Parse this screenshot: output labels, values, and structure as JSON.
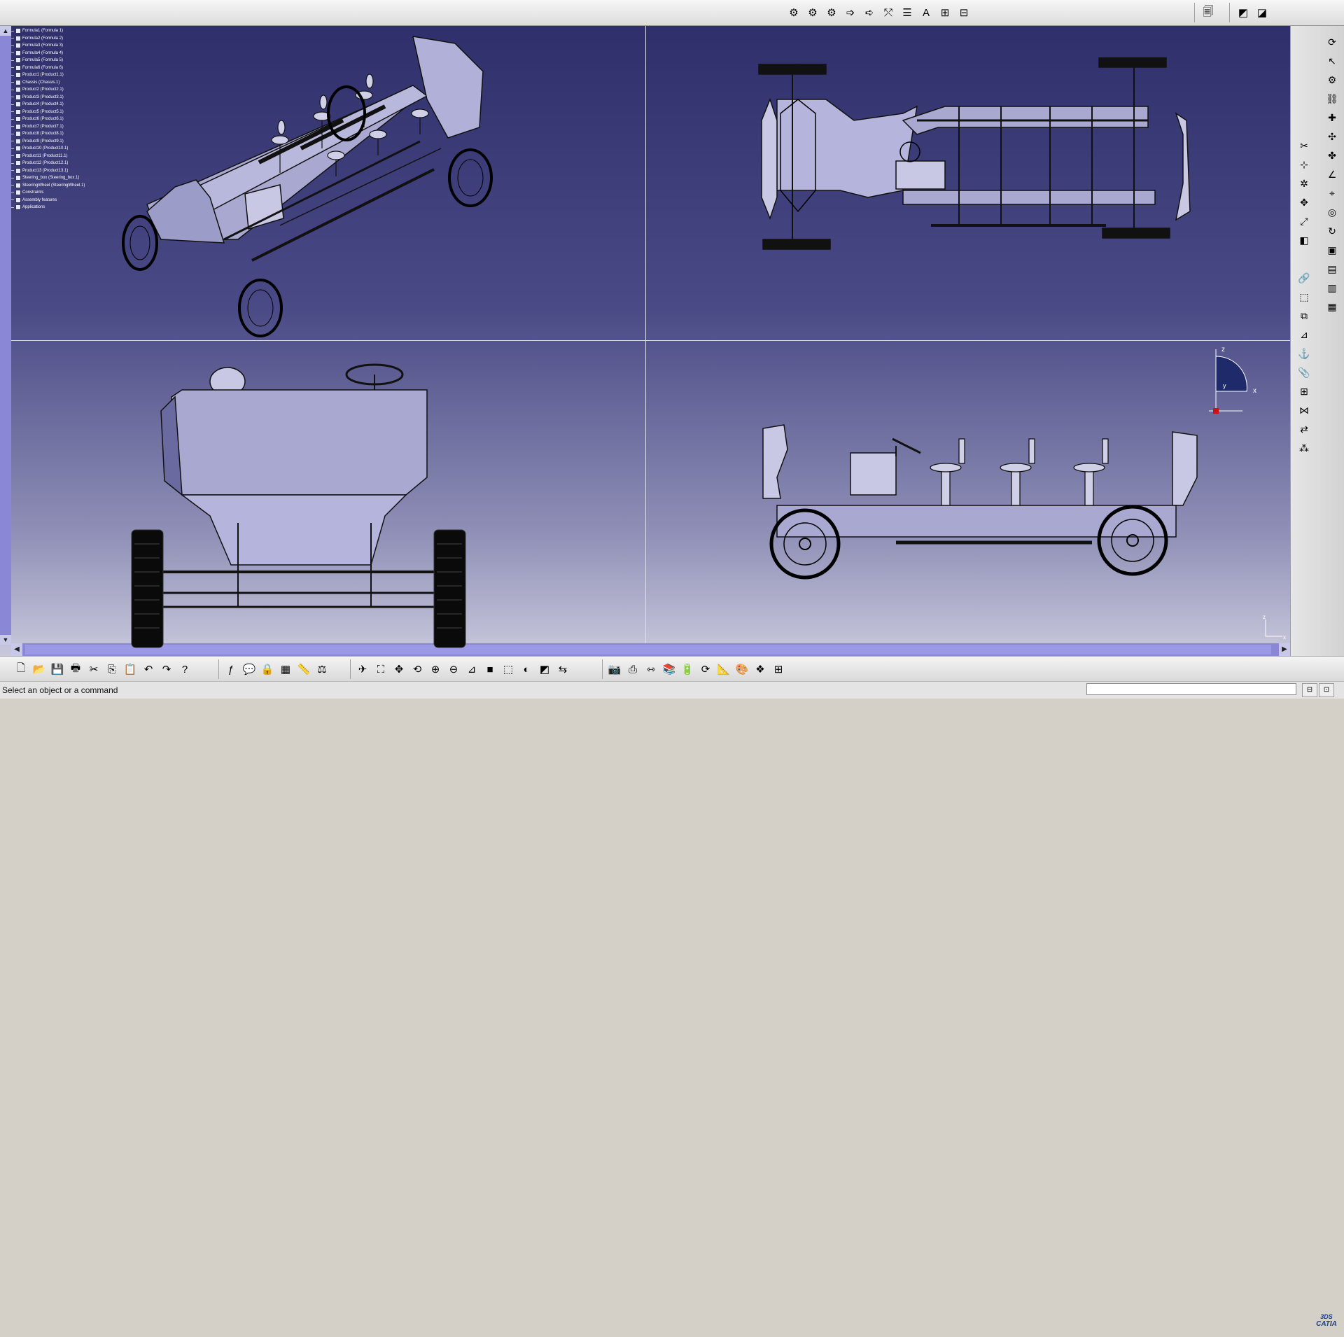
{
  "app": {
    "brand": "CATIA",
    "brand_prefix": "3DS"
  },
  "colors": {
    "viewport_top": "#2f2f6b",
    "viewport_bottom": "#c8c8dc",
    "model_fill": "#a8a8d0",
    "scroll": "#8a88d6"
  },
  "tree": {
    "items": [
      "Formula1 (Formula 1)",
      "Formula2 (Formula 2)",
      "Formula3 (Formula 3)",
      "Formula4 (Formula 4)",
      "Formula5 (Formula 5)",
      "Formula6 (Formula 6)",
      "Product1 (Product1.1)",
      "Chassis (Chassis.1)",
      "Product2 (Product2.1)",
      "Product3 (Product3.1)",
      "Product4 (Product4.1)",
      "Product5 (Product5.1)",
      "Product6 (Product6.1)",
      "Product7 (Product7.1)",
      "Product8 (Product8.1)",
      "Product9 (Product9.1)",
      "Product10 (Product10.1)",
      "Product11 (Product11.1)",
      "Product12 (Product12.1)",
      "Product13 (Product13.1)",
      "Steering_box (Steering_box.1)",
      "SteeringWheel (SteeringWheel.1)",
      "Constraints",
      "Assembly features",
      "Applications"
    ]
  },
  "axes": {
    "z": "z",
    "x": "x",
    "y": "y"
  },
  "statusbar": {
    "message": "Select an object or a command",
    "command_placeholder": ""
  },
  "top_toolbar": {
    "group_a": [
      "gear-icon",
      "gear-icon",
      "gear-icon",
      "arrow-right-icon",
      "arrow-right-icon",
      "split-icon",
      "list-icon",
      "text-icon",
      "tree-icon",
      "tree-expand-icon"
    ],
    "group_b": [
      "bookmark-icon"
    ],
    "group_c": [
      "view-left-icon",
      "view-right-icon"
    ]
  },
  "bottom_toolbar": {
    "file": [
      "new-icon",
      "open-icon",
      "save-icon",
      "print-icon",
      "cut-icon",
      "copy-icon",
      "paste-icon",
      "undo-icon",
      "redo-icon",
      "whats-this-icon"
    ],
    "tools": [
      "formula-icon",
      "comment-icon",
      "lock-icon",
      "table-icon",
      "measure-icon",
      "inertia-icon"
    ],
    "view": [
      "fly-icon",
      "fit-all-icon",
      "pan-icon",
      "rotate-icon",
      "zoom-in-icon",
      "zoom-out-icon",
      "normal-view-icon",
      "cube-icon",
      "iso-view-icon",
      "shading-icon",
      "hide-show-icon",
      "swap-icon"
    ],
    "misc": [
      "camera-icon",
      "capture-icon",
      "dimension-icon",
      "catalog-icon",
      "battery-icon",
      "refresh-icon",
      "rule-icon",
      "color-icon",
      "material-icon",
      "grid-icon"
    ]
  }
}
